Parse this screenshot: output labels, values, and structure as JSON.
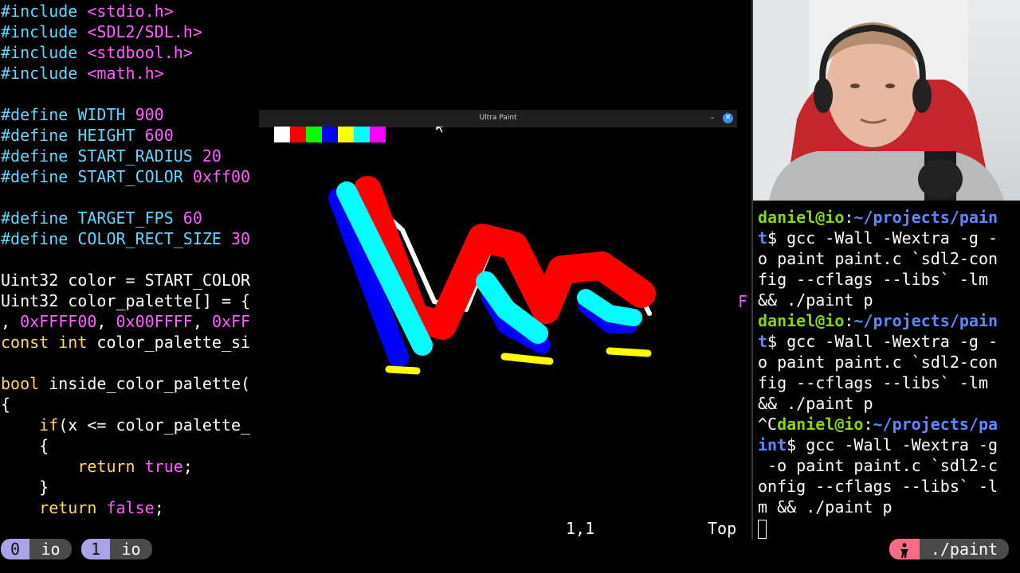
{
  "editor": {
    "lines": [
      {
        "a": "#include ",
        "b": "<stdio.h>"
      },
      {
        "a": "#include ",
        "b": "<SDL2/SDL.h>"
      },
      {
        "a": "#include ",
        "b": "<stdbool.h>"
      },
      {
        "a": "#include ",
        "b": "<math.h>"
      },
      {
        "a": "",
        "b": ""
      },
      {
        "a": "#define ",
        "c": "WIDTH ",
        "n": "900"
      },
      {
        "a": "#define ",
        "c": "HEIGHT ",
        "n": "600"
      },
      {
        "a": "#define ",
        "c": "START_RADIUS ",
        "n": "20"
      },
      {
        "a": "#define ",
        "c": "START_COLOR ",
        "n": "0xff00"
      },
      {
        "a": "",
        "b": ""
      },
      {
        "a": "#define ",
        "c": "TARGET_FPS ",
        "n": "60"
      },
      {
        "a": "#define ",
        "c": "COLOR_RECT_SIZE ",
        "n": "30"
      },
      {
        "a": "",
        "b": ""
      },
      {
        "t": "Uint32 color = START_COLOR"
      },
      {
        "t": "Uint32 color_palette[] = {"
      },
      {
        "t": ", ",
        "n1": "0xFFFF00",
        ", ": "",
        "n2": "0x00FFFF",
        "n3": "0xFF"
      },
      {
        "k": "const int ",
        "t2": "color_palette_si"
      },
      {
        "t": ""
      },
      {
        "k": "bool ",
        "t2": "inside_color_palette("
      },
      {
        "t": "{"
      },
      {
        "t": "    ",
        "k2": "if",
        "t3": "(x <= color_palette_"
      },
      {
        "t": "    {"
      },
      {
        "t": "        ",
        "k2": "return ",
        "n4": "true",
        ";": ";"
      },
      {
        "t": "    }"
      },
      {
        "t": "    ",
        "k2": "return ",
        "n4": "false",
        ";": ";"
      }
    ],
    "stray_char": "F",
    "cursor_position": "1,1",
    "scroll_position": "Top"
  },
  "paint_window": {
    "title": "Ultra Paint",
    "minimize": "–",
    "close": "✕",
    "palette": [
      "#FFFFFF",
      "#FF0000",
      "#00FF00",
      "#0000FF",
      "#FFFF00",
      "#00FFFF",
      "#FF00FF"
    ]
  },
  "terminal": {
    "lines": [
      {
        "user": "daniel@io",
        "sep": ":",
        "path": "~/projects/pain"
      },
      {
        "path": "t",
        "text": "$ gcc -Wall -Wextra -g -"
      },
      {
        "text": "o paint paint.c `sdl2-con"
      },
      {
        "text": "fig --cflags --libs` -lm"
      },
      {
        "text": "&& ./paint p"
      },
      {
        "user": "daniel@io",
        "sep": ":",
        "path": "~/projects/pain"
      },
      {
        "path": "t",
        "text": "$ gcc -Wall -Wextra -g -"
      },
      {
        "text": "o paint paint.c `sdl2-con"
      },
      {
        "text": "fig --cflags --libs` -lm"
      },
      {
        "text": "&& ./paint p"
      },
      {
        "pre": "^C",
        "user": "daniel@io",
        "sep": ":",
        "path": "~/projects/pa"
      },
      {
        "path": "int",
        "text": "$ gcc -Wall -Wextra -g"
      },
      {
        "text": " -o paint paint.c `sdl2-c"
      },
      {
        "text": "onfig --cflags --libs` -l"
      },
      {
        "text": "m && ./paint p"
      }
    ]
  },
  "tmux": {
    "win0_num": "0",
    "win0_name": "io",
    "win1_num": "1",
    "win1_name": "io",
    "process": "./paint"
  }
}
